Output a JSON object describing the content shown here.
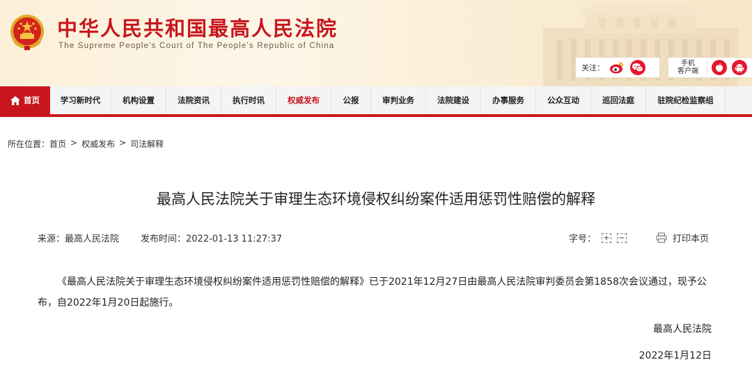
{
  "header": {
    "site_title": "中华人民共和国最高人民法院",
    "site_subtitle": "The Supreme People's Court of The People's Republic of China",
    "follow_label": "关注：",
    "mobile_label_line1": "手机",
    "mobile_label_line2": "客户端",
    "icons": [
      "emblem-icon",
      "weibo-icon",
      "wechat-icon",
      "apple-icon",
      "android-icon"
    ]
  },
  "nav": {
    "home": "首页",
    "items": [
      "学习新时代",
      "机构设置",
      "法院资讯",
      "执行时讯",
      "权威发布",
      "公报",
      "审判业务",
      "法院建设",
      "办事服务",
      "公众互动",
      "巡回法庭",
      "驻院纪检监察组"
    ],
    "active": "权威发布"
  },
  "breadcrumb": {
    "prefix": "所在位置：",
    "items": [
      "首页",
      "权威发布",
      "司法解释"
    ],
    "separator": ">"
  },
  "article": {
    "title": "最高人民法院关于审理生态环境侵权纠纷案件适用惩罚性赔偿的解释",
    "source": "来源：最高人民法院",
    "publish_time": "发布时间：2022-01-13 11:27:37",
    "font_size_label": "字号：",
    "font_plus": "+",
    "font_minus": "−",
    "print_label": "打印本页",
    "body": "《最高人民法院关于审理生态环境侵权纠纷案件适用惩罚性赔偿的解释》已于2021年12月27日由最高人民法院审判委员会第1858次会议通过，现予公布，自2022年1月20日起施行。",
    "signature_org": "最高人民法院",
    "signature_date": "2022年1月12日"
  },
  "colors": {
    "brand_red": "#c8161d",
    "header_bg": "#fbf0d9",
    "nav_bg": "#f4f4f4"
  }
}
